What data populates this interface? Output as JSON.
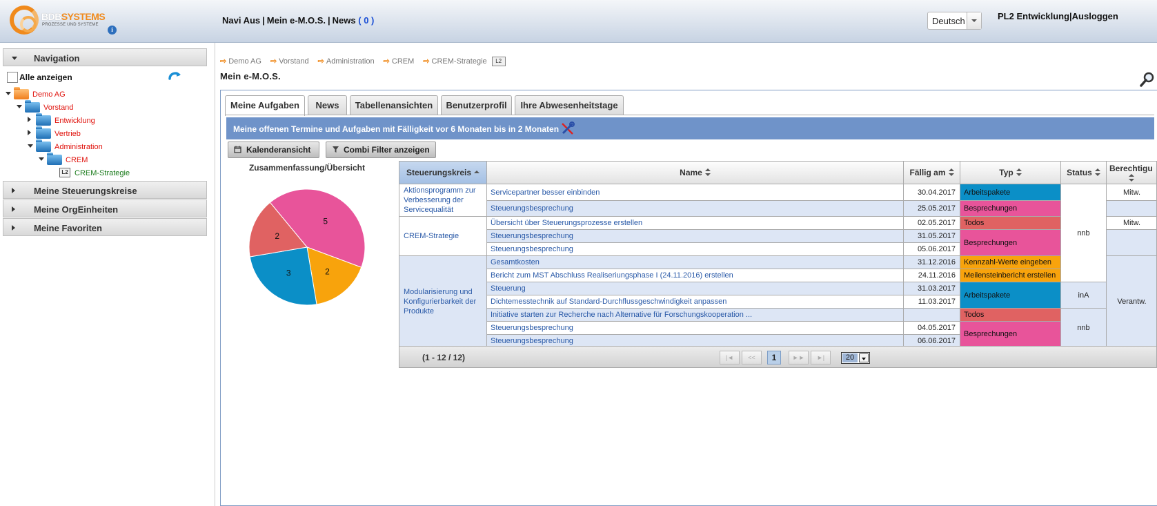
{
  "header": {
    "logo_text": "BDBSYSTEMS",
    "logo_text_a": "BDB",
    "logo_text_b": "SYSTEMS",
    "logo_sub": "PROZESSE UND SYSTEME",
    "info_icon": "i",
    "nav": [
      "Navi Aus",
      "Mein e-M.O.S.",
      "News"
    ],
    "nav_sep": "|",
    "news_count": "( 0 )",
    "language": "Deutsch",
    "user": "PL2 Entwicklung",
    "logout": "Ausloggen"
  },
  "sidebar": {
    "navigation_label": "Navigation",
    "show_all": "Alle anzeigen",
    "tree": [
      {
        "label": "Demo AG",
        "color": "#e0120c"
      },
      {
        "label": "Vorstand",
        "color": "#e0120c"
      },
      {
        "label": "Entwicklung",
        "color": "#e0120c"
      },
      {
        "label": "Vertrieb",
        "color": "#e0120c"
      },
      {
        "label": "Administration",
        "color": "#e0120c"
      },
      {
        "label": "CREM",
        "color": "#e0120c"
      },
      {
        "label": "CREM-Strategie",
        "color": "#197a1a",
        "level": "L2"
      }
    ],
    "sections": [
      "Meine Steuerungskreise",
      "Meine OrgEinheiten",
      "Meine Favoriten"
    ]
  },
  "breadcrumb": [
    "Demo AG",
    "Vorstand",
    "Administration",
    "CREM",
    "CREM-Strategie"
  ],
  "breadcrumb_level": "L2",
  "page_title": "Mein e-M.O.S.",
  "tabs": [
    "Meine Aufgaben",
    "News",
    "Tabellenansichten",
    "Benutzerprofil",
    "Ihre Abwesenheitstage"
  ],
  "active_tab": "Meine Aufgaben",
  "banner": "Meine offenen Termine und Aufgaben mit Fälligkeit vor 6 Monaten bis in 2 Monaten",
  "toolbar": {
    "calendar": "Kalenderansicht",
    "filter": "Combi Filter anzeigen"
  },
  "summary": {
    "title": "Zusammenfassung/Übersicht",
    "chart_data": {
      "type": "pie",
      "title": "Zusammenfassung/Übersicht",
      "slices": [
        {
          "value": 5,
          "color": "#e8549a"
        },
        {
          "value": 2,
          "color": "#f8a30c"
        },
        {
          "value": 3,
          "color": "#0b8fc7"
        },
        {
          "value": 2,
          "color": "#e06262"
        }
      ]
    }
  },
  "table": {
    "columns": [
      "Steuerungskreis",
      "Name",
      "Fällig am",
      "Typ",
      "Status",
      "Berechtigu"
    ],
    "groups": [
      "Aktionsprogramm zur Verbesserung der Servicequalität",
      "CREM-Strategie",
      "Modularisierung und Konfigurierbarkeit der Produkte"
    ],
    "rows": [
      {
        "name": "Servicepartner besser einbinden",
        "due": "30.04.2017"
      },
      {
        "name": "Steuerungsbesprechung",
        "due": "25.05.2017"
      },
      {
        "name": "Übersicht über Steuerungsprozesse erstellen",
        "due": "02.05.2017"
      },
      {
        "name": "Steuerungsbesprechung",
        "due": "31.05.2017"
      },
      {
        "name": "Steuerungsbesprechung",
        "due": "05.06.2017"
      },
      {
        "name": "Gesamtkosten",
        "due": "31.12.2016"
      },
      {
        "name": "Bericht zum MST Abschluss Realiseriungsphase I (24.11.2016) erstellen",
        "due": "24.11.2016"
      },
      {
        "name": "Steuerung",
        "due": "31.03.2017"
      },
      {
        "name": "Dichtemesstechnik auf Standard-Durchflussgeschwindigkeit anpassen",
        "due": "11.03.2017"
      },
      {
        "name": "Initiative starten zur Recherche nach Alternative für Forschungskooperation ...",
        "due": ""
      },
      {
        "name": "Steuerungsbesprechung",
        "due": "04.05.2017"
      },
      {
        "name": "Steuerungsbesprechung",
        "due": "06.06.2017"
      }
    ],
    "types": [
      "Arbeitspakete",
      "Besprechungen",
      "Todos",
      "Besprechungen",
      "Kennzahl-Werte eingeben",
      "Meilensteinbericht erstellen",
      "Arbeitspakete",
      "Todos",
      "Besprechungen"
    ],
    "status": [
      "nnb",
      "inA",
      "nnb"
    ],
    "rights": [
      "Mitw.",
      "Mitw.",
      "Verantw."
    ]
  },
  "pager": {
    "range": "(1 - 12 / 12)",
    "current": "1",
    "page_size": "20"
  }
}
